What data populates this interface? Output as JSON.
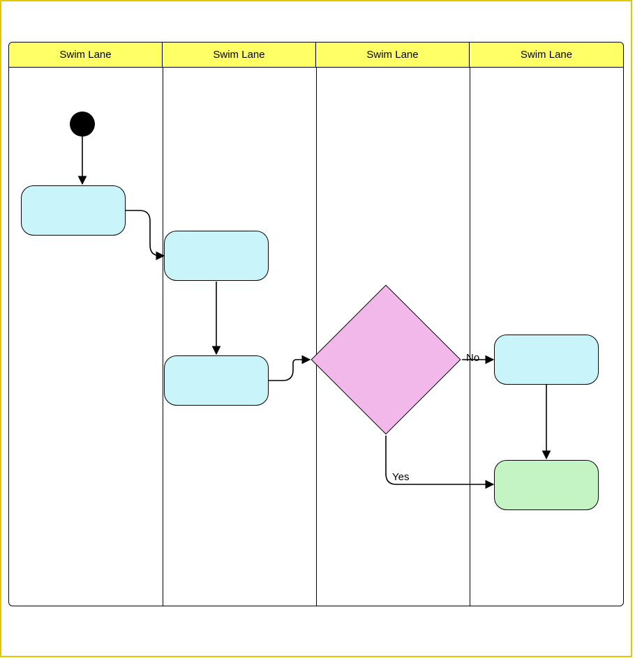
{
  "swimlanes": {
    "headers": [
      "Swim Lane",
      "Swim Lane",
      "Swim Lane",
      "Swim Lane"
    ]
  },
  "nodes": {
    "start": {
      "type": "start"
    },
    "act1": {
      "type": "activity",
      "label": ""
    },
    "act2": {
      "type": "activity",
      "label": ""
    },
    "act3": {
      "type": "activity",
      "label": ""
    },
    "decision": {
      "type": "decision",
      "label": ""
    },
    "act4": {
      "type": "activity",
      "label": ""
    },
    "act5": {
      "type": "activity",
      "label": "",
      "variant": "green"
    }
  },
  "edges": {
    "no_label": "No",
    "yes_label": "Yes"
  },
  "colors": {
    "lane_header_bg": "#ffff66",
    "activity_fill": "#c8f4fa",
    "decision_fill": "#f3b8ea",
    "end_fill": "#c4f3c4",
    "border": "#000000",
    "outer_frame": "#e0c900"
  }
}
